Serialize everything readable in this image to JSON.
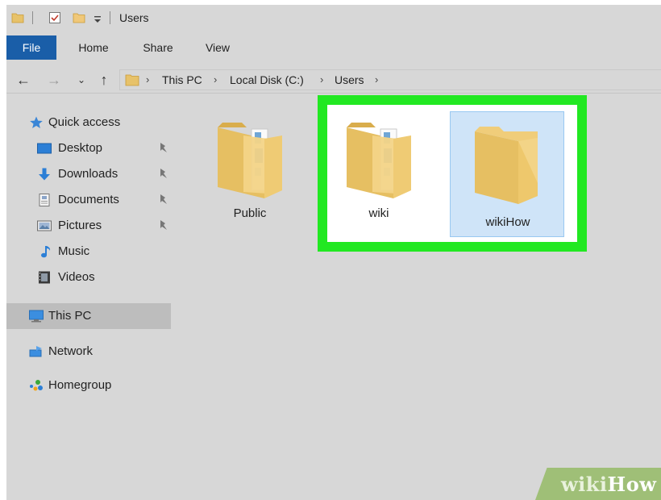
{
  "window": {
    "title": "Users"
  },
  "ribbon": {
    "tabs": [
      "File",
      "Home",
      "Share",
      "View"
    ]
  },
  "address": {
    "crumbs": [
      "This PC",
      "Local Disk (C:)",
      "Users"
    ]
  },
  "nav": {
    "quick_access": "Quick access",
    "items": [
      "Desktop",
      "Downloads",
      "Documents",
      "Pictures",
      "Music",
      "Videos"
    ],
    "this_pc": "This PC",
    "network": "Network",
    "homegroup": "Homegroup"
  },
  "files": [
    {
      "name": "Public"
    },
    {
      "name": "wiki"
    },
    {
      "name": "wikiHow",
      "selected": true
    }
  ],
  "watermark": {
    "part1": "wiki",
    "part2": "How"
  },
  "colors": {
    "file_tab": "#1a5ea8",
    "highlight_border": "#22e822",
    "selection": "#cfe4f8"
  }
}
